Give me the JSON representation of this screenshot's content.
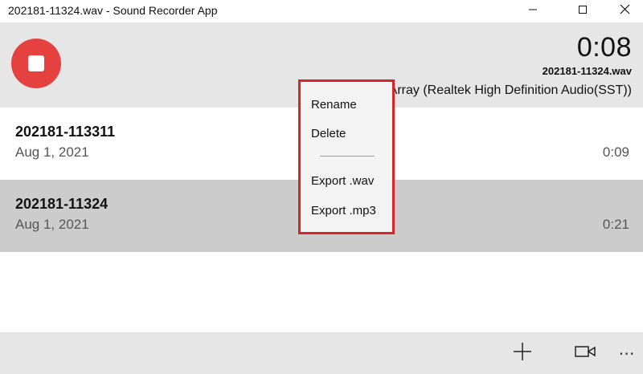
{
  "window": {
    "title": "202181-11324.wav - Sound Recorder App",
    "min_icon": "minimize-icon",
    "max_icon": "maximize-icon",
    "close_icon": "close-icon"
  },
  "recorder": {
    "timer": "0:08",
    "current_file": "202181-11324.wav",
    "device": "e Array (Realtek High Definition Audio(SST))",
    "record_button_icon": "stop-icon",
    "accent_color": "#e5413f"
  },
  "recordings": [
    {
      "name": "202181-113311",
      "date": "Aug 1, 2021",
      "duration": "0:09",
      "selected": false
    },
    {
      "name": "202181-11324",
      "date": "Aug 1, 2021",
      "duration": "0:21",
      "selected": true
    }
  ],
  "context_menu": {
    "items": [
      "Rename",
      "Delete",
      "Export .wav",
      "Export .mp3"
    ],
    "highlight_color": "#d7262a"
  },
  "bottom_bar": {
    "add_icon": "plus-icon",
    "video_icon": "video-camera-icon",
    "more_label": "⋯"
  }
}
